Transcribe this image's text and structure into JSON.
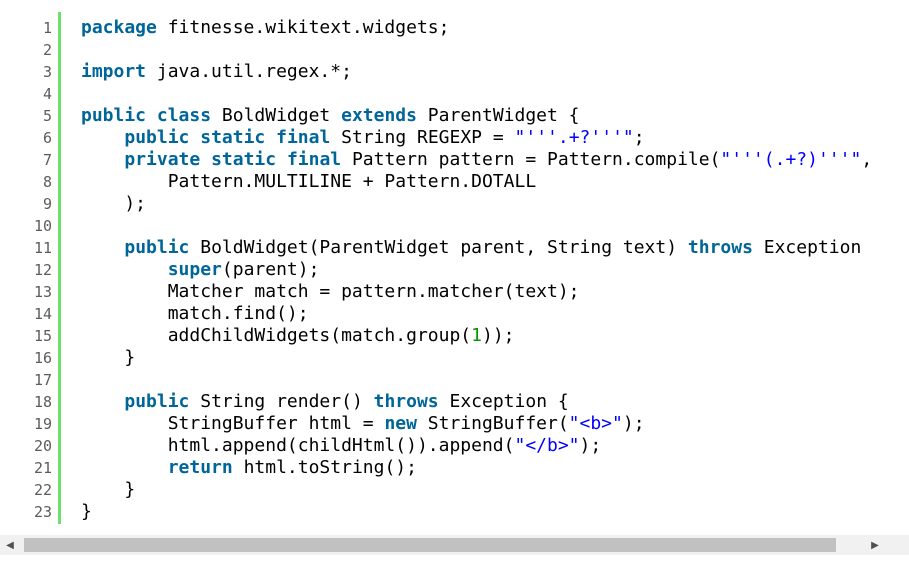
{
  "editor": {
    "line_numbers": [
      "1",
      "2",
      "3",
      "4",
      "5",
      "6",
      "7",
      "8",
      "9",
      "10",
      "11",
      "12",
      "13",
      "14",
      "15",
      "16",
      "17",
      "18",
      "19",
      "20",
      "21",
      "22",
      "23"
    ],
    "lines": [
      [
        {
          "t": "kw",
          "v": "package"
        },
        {
          "t": "plain",
          "v": " fitnesse.wikitext.widgets;"
        }
      ],
      [],
      [
        {
          "t": "kw",
          "v": "import"
        },
        {
          "t": "plain",
          "v": " java.util.regex.*;"
        }
      ],
      [],
      [
        {
          "t": "kw",
          "v": "public"
        },
        {
          "t": "plain",
          "v": " "
        },
        {
          "t": "kw",
          "v": "class"
        },
        {
          "t": "plain",
          "v": " BoldWidget "
        },
        {
          "t": "kw",
          "v": "extends"
        },
        {
          "t": "plain",
          "v": " ParentWidget {"
        }
      ],
      [
        {
          "t": "plain",
          "v": "    "
        },
        {
          "t": "kw",
          "v": "public"
        },
        {
          "t": "plain",
          "v": " "
        },
        {
          "t": "kw",
          "v": "static"
        },
        {
          "t": "plain",
          "v": " "
        },
        {
          "t": "kw",
          "v": "final"
        },
        {
          "t": "plain",
          "v": " String REGEXP = "
        },
        {
          "t": "str",
          "v": "\"'''.+?'''\""
        },
        {
          "t": "plain",
          "v": ";"
        }
      ],
      [
        {
          "t": "plain",
          "v": "    "
        },
        {
          "t": "kw",
          "v": "private"
        },
        {
          "t": "plain",
          "v": " "
        },
        {
          "t": "kw",
          "v": "static"
        },
        {
          "t": "plain",
          "v": " "
        },
        {
          "t": "kw",
          "v": "final"
        },
        {
          "t": "plain",
          "v": " Pattern pattern = Pattern.compile("
        },
        {
          "t": "str",
          "v": "\"'''(.+?)'''\""
        },
        {
          "t": "plain",
          "v": ","
        }
      ],
      [
        {
          "t": "plain",
          "v": "        Pattern.MULTILINE + Pattern.DOTALL"
        }
      ],
      [
        {
          "t": "plain",
          "v": "    );"
        }
      ],
      [],
      [
        {
          "t": "plain",
          "v": "    "
        },
        {
          "t": "kw",
          "v": "public"
        },
        {
          "t": "plain",
          "v": " BoldWidget(ParentWidget parent, String text) "
        },
        {
          "t": "kw",
          "v": "throws"
        },
        {
          "t": "plain",
          "v": " Exception"
        }
      ],
      [
        {
          "t": "plain",
          "v": "        "
        },
        {
          "t": "kw",
          "v": "super"
        },
        {
          "t": "plain",
          "v": "(parent);"
        }
      ],
      [
        {
          "t": "plain",
          "v": "        Matcher match = pattern.matcher(text);"
        }
      ],
      [
        {
          "t": "plain",
          "v": "        match.find();"
        }
      ],
      [
        {
          "t": "plain",
          "v": "        addChildWidgets(match.group("
        },
        {
          "t": "num",
          "v": "1"
        },
        {
          "t": "plain",
          "v": "));"
        }
      ],
      [
        {
          "t": "plain",
          "v": "    }"
        }
      ],
      [],
      [
        {
          "t": "plain",
          "v": "    "
        },
        {
          "t": "kw",
          "v": "public"
        },
        {
          "t": "plain",
          "v": " String render() "
        },
        {
          "t": "kw",
          "v": "throws"
        },
        {
          "t": "plain",
          "v": " Exception {"
        }
      ],
      [
        {
          "t": "plain",
          "v": "        StringBuffer html = "
        },
        {
          "t": "kw",
          "v": "new"
        },
        {
          "t": "plain",
          "v": " StringBuffer("
        },
        {
          "t": "str",
          "v": "\"<b>\""
        },
        {
          "t": "plain",
          "v": ");"
        }
      ],
      [
        {
          "t": "plain",
          "v": "        html.append(childHtml()).append("
        },
        {
          "t": "str",
          "v": "\"</b>\""
        },
        {
          "t": "plain",
          "v": ");"
        }
      ],
      [
        {
          "t": "plain",
          "v": "        "
        },
        {
          "t": "kw",
          "v": "return"
        },
        {
          "t": "plain",
          "v": " html.toString();"
        }
      ],
      [
        {
          "t": "plain",
          "v": "    }"
        }
      ],
      [
        {
          "t": "plain",
          "v": "}"
        }
      ]
    ]
  },
  "scrollbar": {
    "left_arrow": "◀",
    "right_arrow": "▶"
  },
  "colors": {
    "keyword": "#006699",
    "string": "#0000ff",
    "number": "#009900",
    "gutter_bar": "#6ce26c",
    "line_number": "#5c5c5c"
  }
}
